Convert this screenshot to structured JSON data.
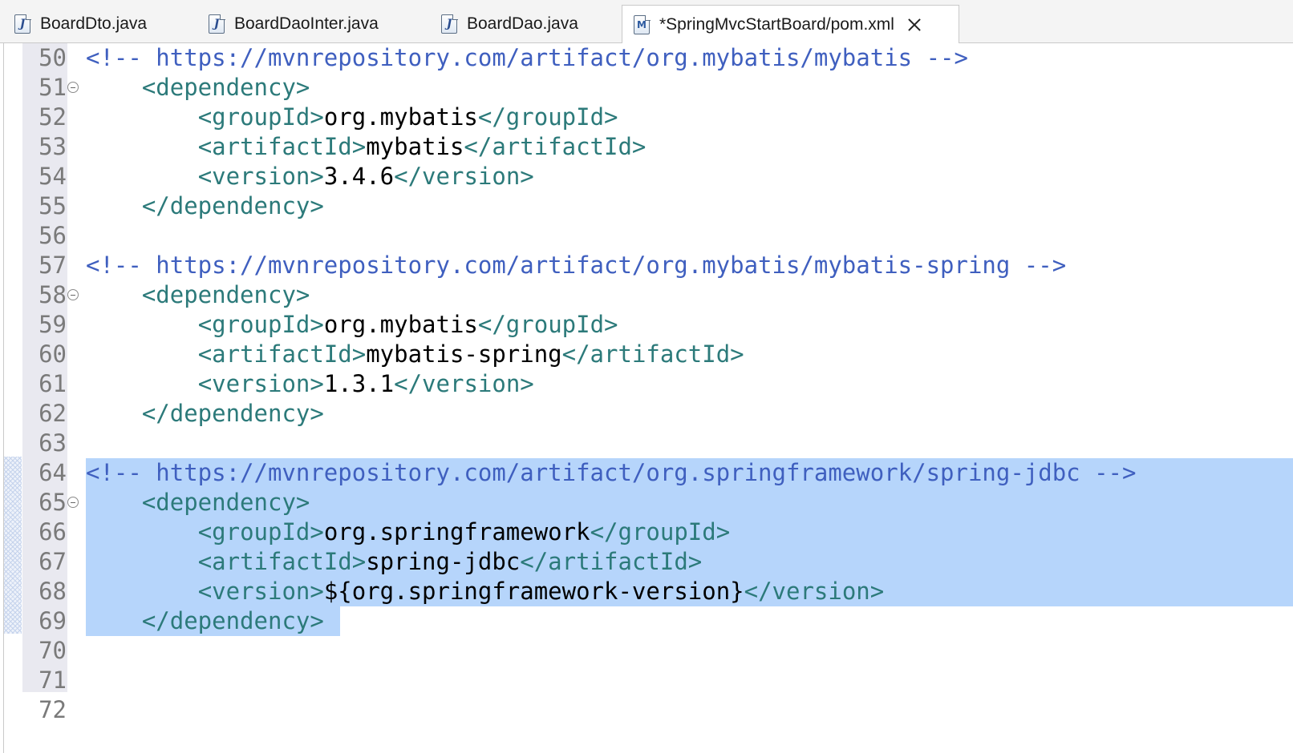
{
  "tabs": [
    {
      "label": "BoardDto.java",
      "icon": "java-file-icon",
      "glyph": "J",
      "active": false,
      "dirty": false
    },
    {
      "label": "BoardDaoInter.java",
      "icon": "java-file-icon",
      "glyph": "J",
      "active": false,
      "dirty": false
    },
    {
      "label": "BoardDao.java",
      "icon": "java-file-icon",
      "glyph": "J",
      "active": false,
      "dirty": false
    },
    {
      "label": "*SpringMvcStartBoard/pom.xml",
      "icon": "maven-pom-file-icon",
      "glyph": "M",
      "active": true,
      "dirty": true
    }
  ],
  "editor": {
    "colors": {
      "comment": "#3f5fbf",
      "tag": "#2c7a7a",
      "text": "#000000",
      "selection": "#b6d5fb",
      "ruler": "#e9e9f0"
    },
    "lines": [
      {
        "num": "50",
        "fold": false,
        "selected": false,
        "tokens": [
          [
            "comment",
            "<!-- https://mvnrepository.com/artifact/org.mybatis/mybatis -->"
          ]
        ]
      },
      {
        "num": "51",
        "fold": true,
        "selected": false,
        "tokens": [
          [
            "text",
            "    "
          ],
          [
            "tag",
            "<dependency>"
          ]
        ]
      },
      {
        "num": "52",
        "fold": false,
        "selected": false,
        "tokens": [
          [
            "text",
            "        "
          ],
          [
            "tag",
            "<groupId>"
          ],
          [
            "text",
            "org.mybatis"
          ],
          [
            "tag",
            "</groupId>"
          ]
        ]
      },
      {
        "num": "53",
        "fold": false,
        "selected": false,
        "tokens": [
          [
            "text",
            "        "
          ],
          [
            "tag",
            "<artifactId>"
          ],
          [
            "text",
            "mybatis"
          ],
          [
            "tag",
            "</artifactId>"
          ]
        ]
      },
      {
        "num": "54",
        "fold": false,
        "selected": false,
        "tokens": [
          [
            "text",
            "        "
          ],
          [
            "tag",
            "<version>"
          ],
          [
            "text",
            "3.4.6"
          ],
          [
            "tag",
            "</version>"
          ]
        ]
      },
      {
        "num": "55",
        "fold": false,
        "selected": false,
        "tokens": [
          [
            "text",
            "    "
          ],
          [
            "tag",
            "</dependency>"
          ]
        ]
      },
      {
        "num": "56",
        "fold": false,
        "selected": false,
        "tokens": []
      },
      {
        "num": "57",
        "fold": false,
        "selected": false,
        "tokens": [
          [
            "comment",
            "<!-- https://mvnrepository.com/artifact/org.mybatis/mybatis-spring -->"
          ]
        ]
      },
      {
        "num": "58",
        "fold": true,
        "selected": false,
        "tokens": [
          [
            "text",
            "    "
          ],
          [
            "tag",
            "<dependency>"
          ]
        ]
      },
      {
        "num": "59",
        "fold": false,
        "selected": false,
        "tokens": [
          [
            "text",
            "        "
          ],
          [
            "tag",
            "<groupId>"
          ],
          [
            "text",
            "org.mybatis"
          ],
          [
            "tag",
            "</groupId>"
          ]
        ]
      },
      {
        "num": "60",
        "fold": false,
        "selected": false,
        "tokens": [
          [
            "text",
            "        "
          ],
          [
            "tag",
            "<artifactId>"
          ],
          [
            "text",
            "mybatis-spring"
          ],
          [
            "tag",
            "</artifactId>"
          ]
        ]
      },
      {
        "num": "61",
        "fold": false,
        "selected": false,
        "tokens": [
          [
            "text",
            "        "
          ],
          [
            "tag",
            "<version>"
          ],
          [
            "text",
            "1.3.1"
          ],
          [
            "tag",
            "</version>"
          ]
        ]
      },
      {
        "num": "62",
        "fold": false,
        "selected": false,
        "tokens": [
          [
            "text",
            "    "
          ],
          [
            "tag",
            "</dependency>"
          ]
        ]
      },
      {
        "num": "63",
        "fold": false,
        "selected": false,
        "tokens": []
      },
      {
        "num": "64",
        "fold": false,
        "selected": "full",
        "tokens": [
          [
            "comment",
            "<!-- https://mvnrepository.com/artifact/org.springframework/spring-jdbc -->"
          ]
        ]
      },
      {
        "num": "65",
        "fold": true,
        "selected": "full",
        "tokens": [
          [
            "text",
            "    "
          ],
          [
            "tag",
            "<dependency>"
          ]
        ]
      },
      {
        "num": "66",
        "fold": false,
        "selected": "full",
        "tokens": [
          [
            "text",
            "        "
          ],
          [
            "tag",
            "<groupId>"
          ],
          [
            "text",
            "org.springframework"
          ],
          [
            "tag",
            "</groupId>"
          ]
        ]
      },
      {
        "num": "67",
        "fold": false,
        "selected": "full",
        "tokens": [
          [
            "text",
            "        "
          ],
          [
            "tag",
            "<artifactId>"
          ],
          [
            "text",
            "spring-jdbc"
          ],
          [
            "tag",
            "</artifactId>"
          ]
        ]
      },
      {
        "num": "68",
        "fold": false,
        "selected": "full",
        "tokens": [
          [
            "text",
            "        "
          ],
          [
            "tag",
            "<version>"
          ],
          [
            "text",
            "${org.springframework-version}"
          ],
          [
            "tag",
            "</version>"
          ]
        ]
      },
      {
        "num": "69",
        "fold": false,
        "selected": "partial",
        "tokens": [
          [
            "text",
            "    "
          ],
          [
            "tag",
            "</dependency>"
          ]
        ]
      },
      {
        "num": "70",
        "fold": false,
        "selected": false,
        "tokens": []
      },
      {
        "num": "71",
        "fold": false,
        "selected": false,
        "tokens": []
      },
      {
        "num": "72",
        "fold": false,
        "selected": false,
        "tokens": []
      }
    ]
  }
}
